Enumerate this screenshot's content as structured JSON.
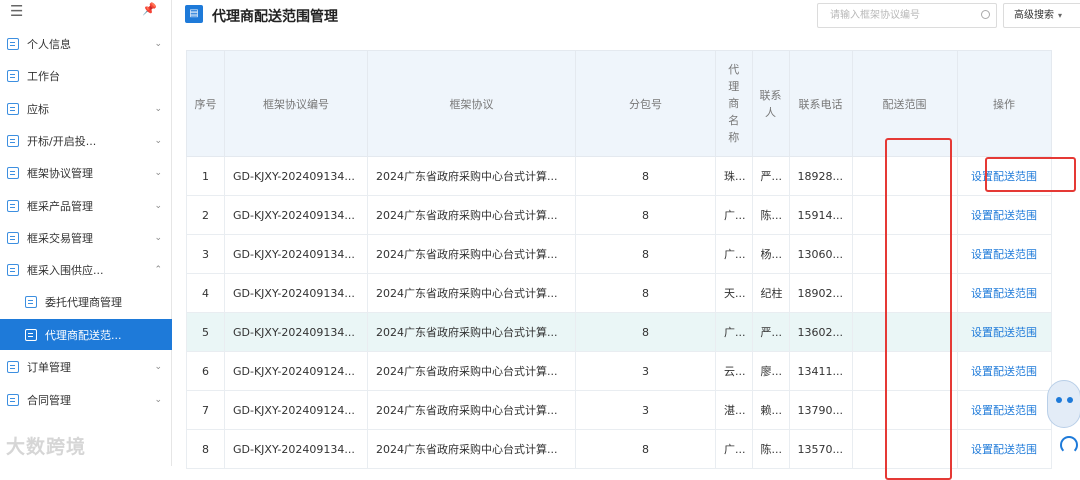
{
  "sidebar": {
    "items": [
      {
        "label": "个人信息",
        "chevron": "down"
      },
      {
        "label": "工作台",
        "chevron": ""
      },
      {
        "label": "应标",
        "chevron": "down"
      },
      {
        "label": "开标/开启投...",
        "chevron": "down"
      },
      {
        "label": "框架协议管理",
        "chevron": "down"
      },
      {
        "label": "框采产品管理",
        "chevron": "down"
      },
      {
        "label": "框采交易管理",
        "chevron": "down"
      },
      {
        "label": "框采入围供应...",
        "chevron": "up"
      },
      {
        "label": "委托代理商管理",
        "chevron": ""
      },
      {
        "label": "代理商配送范...",
        "chevron": ""
      },
      {
        "label": "订单管理",
        "chevron": "down"
      },
      {
        "label": "合同管理",
        "chevron": "down"
      }
    ],
    "watermark": "大数跨境"
  },
  "header": {
    "title": "代理商配送范围管理",
    "search_placeholder": "请输入框架协议编号",
    "advanced_search": "高级搜索"
  },
  "table": {
    "columns": [
      "序号",
      "框架协议编号",
      "框架协议",
      "分包号",
      "代理商名称",
      "联系人",
      "联系电话",
      "配送范围",
      "操作"
    ],
    "rows": [
      {
        "no": "1",
        "code": "GD-KJXY-202409134...",
        "name": "2024广东省政府采购中心台式计算...",
        "pkg": "8",
        "agent": "珠...",
        "contact": "严...",
        "phone": "18928...",
        "scope": "",
        "action": "设置配送范围"
      },
      {
        "no": "2",
        "code": "GD-KJXY-202409134...",
        "name": "2024广东省政府采购中心台式计算...",
        "pkg": "8",
        "agent": "广...",
        "contact": "陈...",
        "phone": "15914...",
        "scope": "",
        "action": "设置配送范围"
      },
      {
        "no": "3",
        "code": "GD-KJXY-202409134...",
        "name": "2024广东省政府采购中心台式计算...",
        "pkg": "8",
        "agent": "广...",
        "contact": "杨...",
        "phone": "13060...",
        "scope": "",
        "action": "设置配送范围"
      },
      {
        "no": "4",
        "code": "GD-KJXY-202409134...",
        "name": "2024广东省政府采购中心台式计算...",
        "pkg": "8",
        "agent": "天...",
        "contact": "纪柱",
        "phone": "18902...",
        "scope": "",
        "action": "设置配送范围"
      },
      {
        "no": "5",
        "code": "GD-KJXY-202409134...",
        "name": "2024广东省政府采购中心台式计算...",
        "pkg": "8",
        "agent": "广...",
        "contact": "严...",
        "phone": "13602...",
        "scope": "",
        "action": "设置配送范围"
      },
      {
        "no": "6",
        "code": "GD-KJXY-202409124...",
        "name": "2024广东省政府采购中心台式计算...",
        "pkg": "3",
        "agent": "云...",
        "contact": "廖...",
        "phone": "13411...",
        "scope": "",
        "action": "设置配送范围"
      },
      {
        "no": "7",
        "code": "GD-KJXY-202409124...",
        "name": "2024广东省政府采购中心台式计算...",
        "pkg": "3",
        "agent": "湛...",
        "contact": "赖...",
        "phone": "13790...",
        "scope": "",
        "action": "设置配送范围"
      },
      {
        "no": "8",
        "code": "GD-KJXY-202409134...",
        "name": "2024广东省政府采购中心台式计算...",
        "pkg": "8",
        "agent": "广...",
        "contact": "陈...",
        "phone": "13570...",
        "scope": "",
        "action": "设置配送范围"
      }
    ]
  },
  "colors": {
    "accent": "#1e7ad9",
    "highlight_row": "#eaf6f6",
    "annotation": "#e53935"
  }
}
